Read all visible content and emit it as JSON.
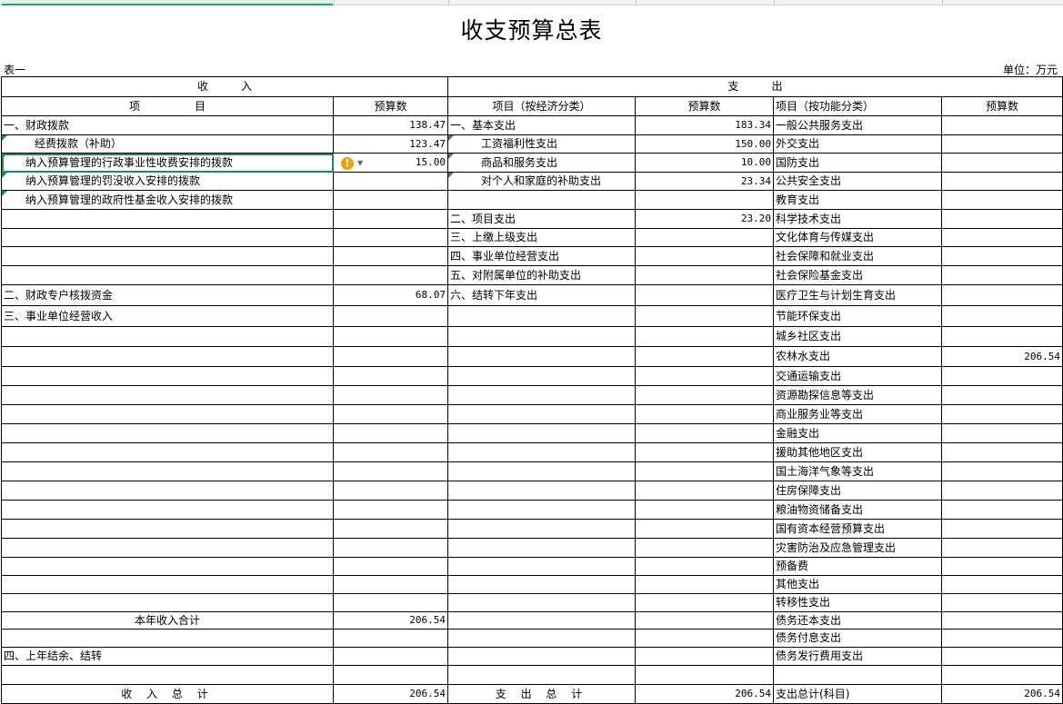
{
  "sheet": {
    "title": "收支预算总表",
    "table_id": "表一",
    "unit": "单位：万元"
  },
  "header": {
    "income_section": "收　　　入",
    "expense_section": "支　　　出",
    "income_item": "项　　　　　目",
    "income_budget": "预算数",
    "expense_econ_item": "项目（按经济分类）",
    "expense_econ_budget": "预算数",
    "expense_func_item": "项目（按功能分类）",
    "expense_func_budget": "预算数"
  },
  "rows": [
    {
      "inc": "一、财政拨款",
      "inc_v": "138.47",
      "econ": "一、基本支出",
      "econ_v": "183.34",
      "func": "一般公共服务支出",
      "func_v": ""
    },
    {
      "inc": "经费拨款（补助）",
      "inc_v": "123.47",
      "econ": "工资福利性支出",
      "econ_v": "150.00",
      "func": "外交支出",
      "func_v": ""
    },
    {
      "inc": "纳入预算管理的行政事业性收费安排的拨款",
      "inc_v": "15.00",
      "econ": "商品和服务支出",
      "econ_v": "10.00",
      "func": "国防支出",
      "func_v": ""
    },
    {
      "inc": "纳入预算管理的罚没收入安排的拨款",
      "inc_v": "",
      "econ": "对个人和家庭的补助支出",
      "econ_v": "23.34",
      "func": "公共安全支出",
      "func_v": ""
    },
    {
      "inc": "纳入预算管理的政府性基金收入安排的拨款",
      "inc_v": "",
      "econ": "",
      "econ_v": "",
      "func": "教育支出",
      "func_v": ""
    },
    {
      "inc": "",
      "inc_v": "",
      "econ": "二、项目支出",
      "econ_v": "23.20",
      "func": "科学技术支出",
      "func_v": ""
    },
    {
      "inc": "",
      "inc_v": "",
      "econ": "三、上缴上级支出",
      "econ_v": "",
      "func": "文化体育与传媒支出",
      "func_v": ""
    },
    {
      "inc": "",
      "inc_v": "",
      "econ": "四、事业单位经营支出",
      "econ_v": "",
      "func": "社会保障和就业支出",
      "func_v": ""
    },
    {
      "inc": "",
      "inc_v": "",
      "econ": "五、对附属单位的补助支出",
      "econ_v": "",
      "func": "社会保险基金支出",
      "func_v": ""
    },
    {
      "inc": "二、财政专户核拨资金",
      "inc_v": "68.07",
      "econ": "六、结转下年支出",
      "econ_v": "",
      "func": "医疗卫生与计划生育支出",
      "func_v": ""
    },
    {
      "inc": "三、事业单位经营收入",
      "inc_v": "",
      "econ": "",
      "econ_v": "",
      "func": "节能环保支出",
      "func_v": ""
    },
    {
      "inc": "",
      "inc_v": "",
      "econ": "",
      "econ_v": "",
      "func": "城乡社区支出",
      "func_v": ""
    },
    {
      "inc": "",
      "inc_v": "",
      "econ": "",
      "econ_v": "",
      "func": "农林水支出",
      "func_v": "206.54"
    },
    {
      "inc": "",
      "inc_v": "",
      "econ": "",
      "econ_v": "",
      "func": "交通运输支出",
      "func_v": ""
    },
    {
      "inc": "",
      "inc_v": "",
      "econ": "",
      "econ_v": "",
      "func": "资源勘探信息等支出",
      "func_v": ""
    },
    {
      "inc": "",
      "inc_v": "",
      "econ": "",
      "econ_v": "",
      "func": "商业服务业等支出",
      "func_v": ""
    },
    {
      "inc": "",
      "inc_v": "",
      "econ": "",
      "econ_v": "",
      "func": "金融支出",
      "func_v": ""
    },
    {
      "inc": "",
      "inc_v": "",
      "econ": "",
      "econ_v": "",
      "func": "援助其他地区支出",
      "func_v": ""
    },
    {
      "inc": "",
      "inc_v": "",
      "econ": "",
      "econ_v": "",
      "func": "国土海洋气象等支出",
      "func_v": ""
    },
    {
      "inc": "",
      "inc_v": "",
      "econ": "",
      "econ_v": "",
      "func": "住房保障支出",
      "func_v": ""
    },
    {
      "inc": "",
      "inc_v": "",
      "econ": "",
      "econ_v": "",
      "func": "粮油物资储备支出",
      "func_v": ""
    },
    {
      "inc": "",
      "inc_v": "",
      "econ": "",
      "econ_v": "",
      "func": "国有资本经营预算支出",
      "func_v": ""
    },
    {
      "inc": "",
      "inc_v": "",
      "econ": "",
      "econ_v": "",
      "func": "灾害防治及应急管理支出",
      "func_v": ""
    },
    {
      "inc": "",
      "inc_v": "",
      "econ": "",
      "econ_v": "",
      "func": "预备费",
      "func_v": ""
    },
    {
      "inc": "",
      "inc_v": "",
      "econ": "",
      "econ_v": "",
      "func": "其他支出",
      "func_v": ""
    },
    {
      "inc": "",
      "inc_v": "",
      "econ": "",
      "econ_v": "",
      "func": "转移性支出",
      "func_v": ""
    },
    {
      "inc": "本年收入合计",
      "inc_v": "206.54",
      "econ": "",
      "econ_v": "",
      "func": "债务还本支出",
      "func_v": ""
    },
    {
      "inc": "",
      "inc_v": "",
      "econ": "",
      "econ_v": "",
      "func": "债务付息支出",
      "func_v": ""
    },
    {
      "inc": "四、上年结余、结转",
      "inc_v": "",
      "econ": "",
      "econ_v": "",
      "func": "债务发行费用支出",
      "func_v": ""
    },
    {
      "inc": "",
      "inc_v": "",
      "econ": "",
      "econ_v": "",
      "func": "",
      "func_v": ""
    }
  ],
  "totals": {
    "income_label": "收 入 总 计",
    "income_value": "206.54",
    "expense_label": "支 出 总 计",
    "expense_value": "206.54",
    "func_label": "支出总计(科目)",
    "func_value": "206.54"
  },
  "warning_icon": "exclamation-warning-icon",
  "colors": {
    "selection": "#1e8c5a",
    "warning": "#e8a317"
  }
}
